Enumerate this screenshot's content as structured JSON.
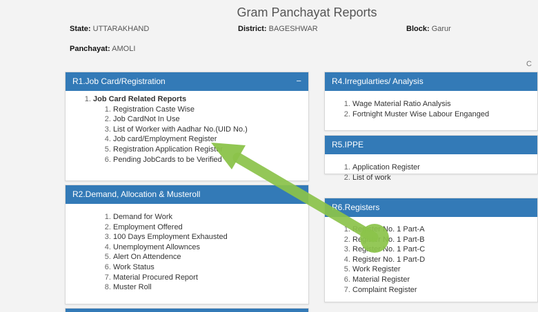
{
  "page": {
    "title": "Gram Panchayat Reports"
  },
  "info": {
    "state_label": "State:",
    "state_value": "UTTARAKHAND",
    "district_label": "District:",
    "district_value": "BAGESHWAR",
    "block_label": "Block:",
    "block_value": "Garur",
    "panchayat_label": "Panchayat:",
    "panchayat_value": "AMOLI"
  },
  "edge_text": "C",
  "panels": {
    "r1": {
      "title": "R1.Job Card/Registration",
      "toggle": "−",
      "group": "Job Card Related Reports",
      "items": [
        "Registration Caste Wise",
        "Job CardNot In Use",
        "List of Worker with Aadhar No.(UID No.)",
        "Job card/Employment Register",
        "Registration Application Register",
        "Pending JobCards to be Verified"
      ]
    },
    "r2": {
      "title": "R2.Demand, Allocation & Musteroll",
      "items": [
        "Demand for Work",
        "Employment Offered",
        "100 Days Employment Exhausted",
        "Unemployment Allownces",
        "Alert On Attendence",
        "Work Status",
        "Material Procured Report",
        "Muster Roll"
      ]
    },
    "r4": {
      "title": "R4.Irregularties/ Analysis",
      "items": [
        "Wage Material Ratio Analysis",
        "Fortnight Muster Wise Labour Enganged"
      ]
    },
    "r5": {
      "title": "R5.IPPE",
      "items": [
        "Application Register",
        "List of work"
      ]
    },
    "r6": {
      "title": "R6.Registers",
      "items": [
        "Register No. 1 Part-A",
        "Register No. 1 Part-B",
        "Register No. 1 Part-C",
        "Register No. 1 Part-D",
        "Work Register",
        "Material Register",
        "Complaint Register"
      ]
    }
  },
  "annotation": {
    "arrow_color": "#8bc34a"
  }
}
